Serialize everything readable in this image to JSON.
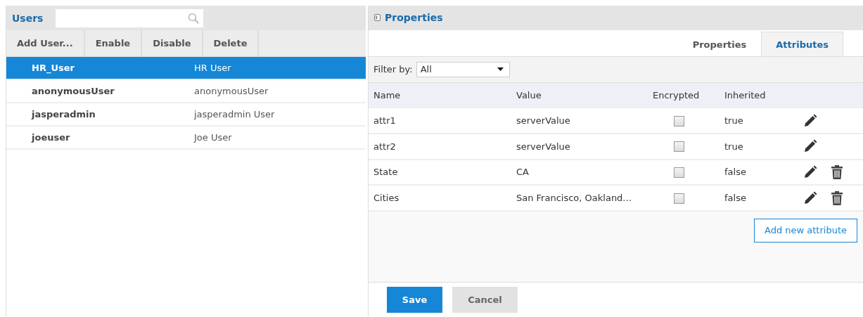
{
  "users_panel": {
    "title": "Users",
    "toolbar": [
      "Add User...",
      "Enable",
      "Disable",
      "Delete"
    ],
    "users": [
      {
        "username": "HR_User",
        "full_name": "HR User",
        "selected": true
      },
      {
        "username": "anonymousUser",
        "full_name": "anonymousUser",
        "selected": false
      },
      {
        "username": "jasperadmin",
        "full_name": "jasperadmin User",
        "selected": false
      },
      {
        "username": "joeuser",
        "full_name": "Joe User",
        "selected": false
      }
    ]
  },
  "properties_panel": {
    "title": "Properties",
    "tabs": [
      {
        "label": "Properties",
        "selected": false
      },
      {
        "label": "Attributes",
        "selected": true
      }
    ],
    "filter": {
      "label": "Filter by:",
      "value": "All"
    },
    "table": {
      "columns": [
        "Name",
        "Value",
        "Encrypted",
        "Inherited"
      ],
      "rows": [
        {
          "name": "attr1",
          "value": "serverValue",
          "encrypted": false,
          "inherited": "true",
          "deletable": false
        },
        {
          "name": "attr2",
          "value": "serverValue",
          "encrypted": false,
          "inherited": "true",
          "deletable": false
        },
        {
          "name": "State",
          "value": "CA",
          "encrypted": false,
          "inherited": "false",
          "deletable": true
        },
        {
          "name": "Cities",
          "value": "San Francisco, Oakland...",
          "encrypted": false,
          "inherited": "false",
          "deletable": true
        }
      ]
    },
    "add_button": "Add new attribute",
    "buttons": [
      "Save",
      "Cancel"
    ]
  }
}
